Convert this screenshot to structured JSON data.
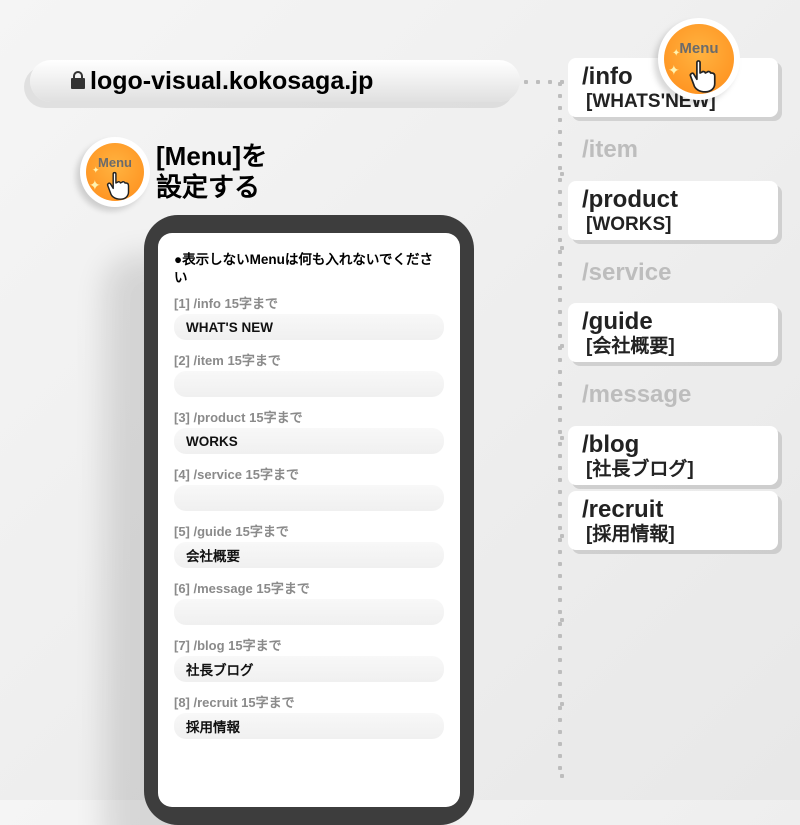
{
  "url_bar": {
    "domain": "logo-visual.kokosaga.jp"
  },
  "badge_label": "Menu",
  "title_line1": "[Menu]を",
  "title_line2": "設定する",
  "form": {
    "note": "●表示しないMenuは何も入れないでください",
    "fields": [
      {
        "label": "[1]  /info  15字まで",
        "value": "WHAT'S NEW"
      },
      {
        "label": "[2]  /item  15字まで",
        "value": ""
      },
      {
        "label": "[3]  /product  15字まで",
        "value": "WORKS"
      },
      {
        "label": "[4]  /service  15字まで",
        "value": ""
      },
      {
        "label": "[5]  /guide  15字まで",
        "value": "会社概要"
      },
      {
        "label": "[6]  /message  15字まで",
        "value": ""
      },
      {
        "label": "[7]  /blog  15字まで",
        "value": "社長ブログ"
      },
      {
        "label": "[8]  /recruit  15字まで",
        "value": "採用情報"
      }
    ]
  },
  "paths": [
    {
      "slug": "/info",
      "label": "[WHATS'NEW]",
      "enabled": true
    },
    {
      "slug": "/item",
      "label": "",
      "enabled": false
    },
    {
      "slug": "/product",
      "label": "[WORKS]",
      "enabled": true
    },
    {
      "slug": "/service",
      "label": "",
      "enabled": false
    },
    {
      "slug": "/guide",
      "label": "[会社概要]",
      "enabled": true
    },
    {
      "slug": "/message",
      "label": "",
      "enabled": false
    },
    {
      "slug": "/blog",
      "label": "[社長ブログ]",
      "enabled": true
    },
    {
      "slug": "/recruit",
      "label": "[採用情報]",
      "enabled": true
    }
  ]
}
